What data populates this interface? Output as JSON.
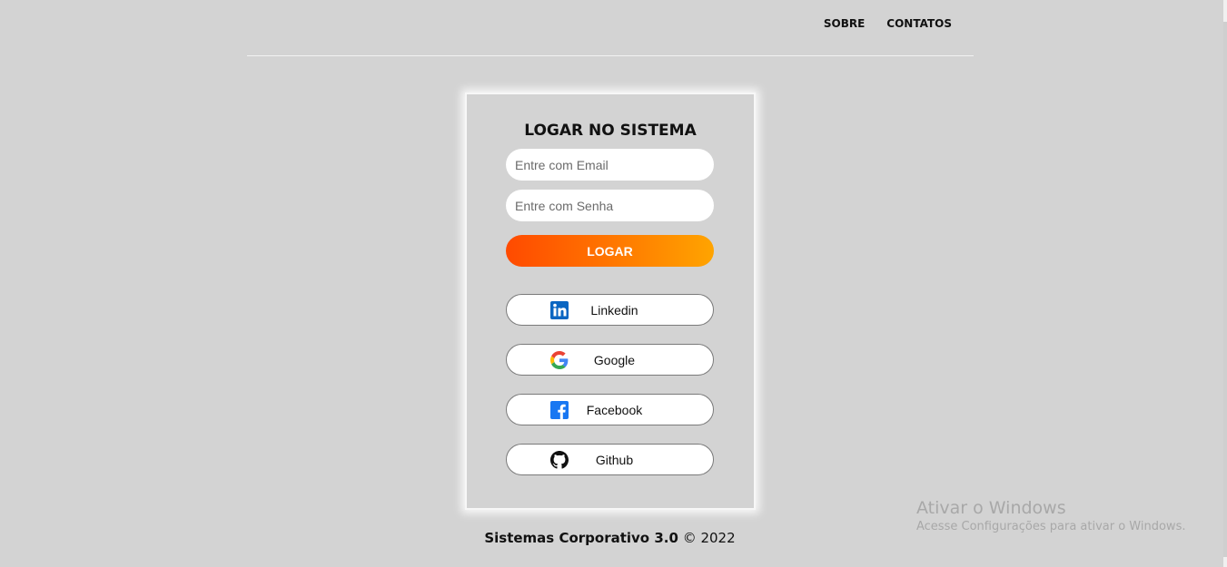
{
  "nav": {
    "links": [
      "SOBRE",
      "CONTATOS"
    ]
  },
  "login": {
    "title": "LOGAR NO SISTEMA",
    "email_placeholder": "Entre com Email",
    "password_placeholder": "Entre com Senha",
    "submit_label": "LOGAR"
  },
  "social": [
    {
      "label": "Linkedin",
      "icon": "linkedin-icon",
      "color": "#0a66c2"
    },
    {
      "label": "Google",
      "icon": "google-icon",
      "color": "#4285f4"
    },
    {
      "label": "Facebook",
      "icon": "facebook-icon",
      "color": "#1877f2"
    },
    {
      "label": "Github",
      "icon": "github-icon",
      "color": "#111111"
    }
  ],
  "footer": {
    "brand": "Sistemas Corporativo 3.0",
    "copyright": "© 2022"
  },
  "watermark": {
    "title": "Ativar o Windows",
    "subtitle": "Acesse Configurações para ativar o Windows."
  },
  "colors": {
    "background": "#d3d3d3",
    "button_gradient_start": "#ff4a00",
    "button_gradient_end": "#ffa400"
  }
}
